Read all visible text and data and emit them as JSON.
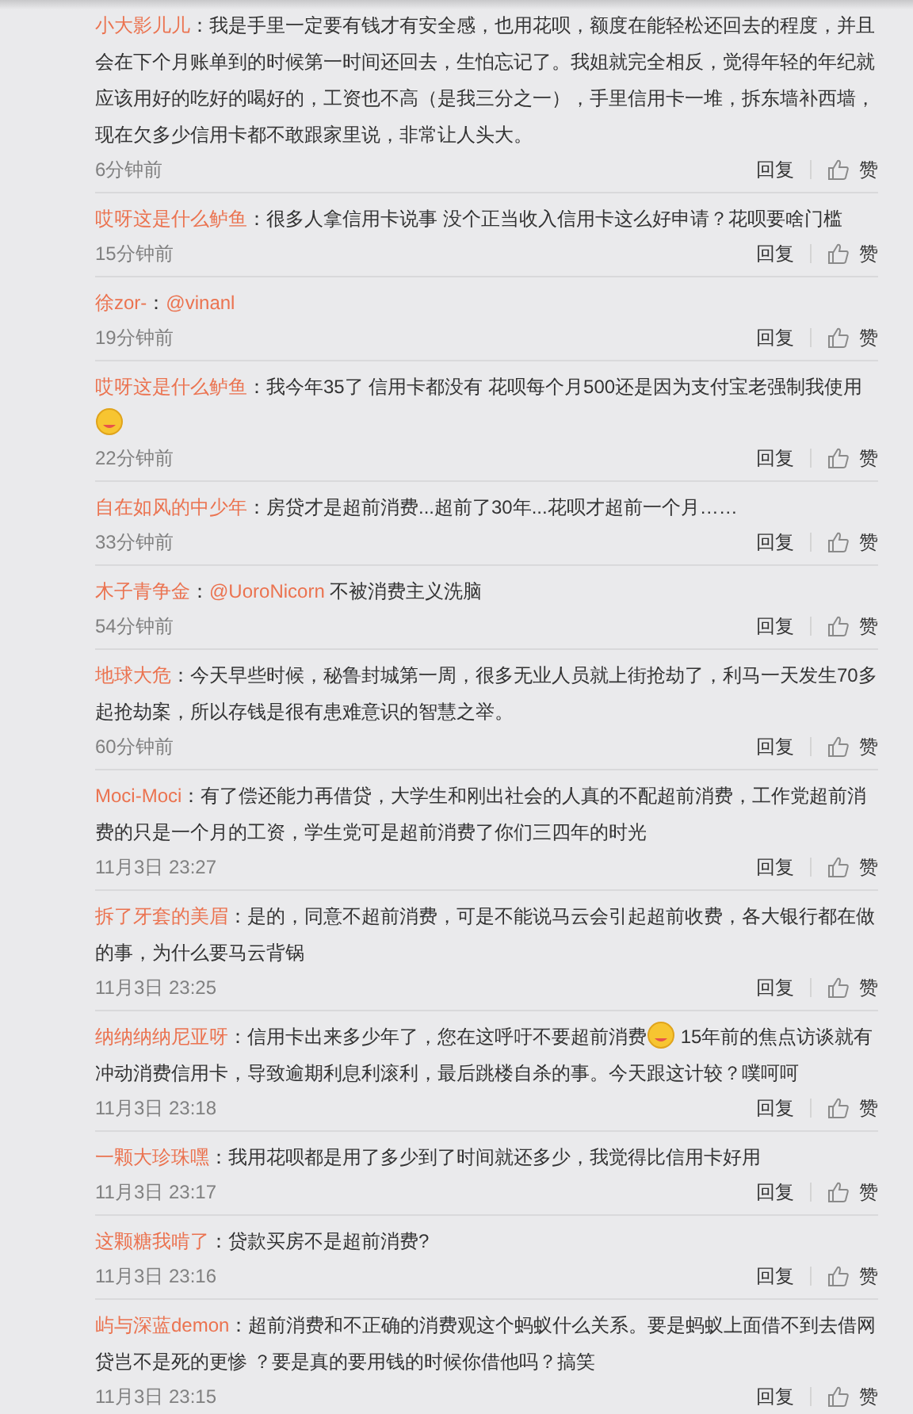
{
  "comments": [
    {
      "user": "小大影儿儿",
      "body": [
        {
          "kind": "text",
          "text": "：我是手里一定要有钱才有安全感，也用花呗，额度在能轻松还回去的程度，并且会在下个月账单到的时候第一时间还回去，生怕忘记了。我姐就完全相反，觉得年轻的年纪就应该用好的吃好的喝好的，工资也不高（是我三分之一），手里信用卡一堆，拆东墙补西墙，现在欠多少信用卡都不敢跟家里说，非常让人头大。"
        }
      ],
      "time": "6分钟前",
      "reply": "回复",
      "like": "赞"
    },
    {
      "user": "哎呀这是什么鲈鱼",
      "body": [
        {
          "kind": "text",
          "text": "：很多人拿信用卡说事 没个正当收入信用卡这么好申请？花呗要啥门槛"
        }
      ],
      "time": "15分钟前",
      "reply": "回复",
      "like": "赞"
    },
    {
      "user": "徐zor-",
      "body": [
        {
          "kind": "text",
          "text": "："
        },
        {
          "kind": "mention",
          "text": "@vinanl"
        }
      ],
      "time": "19分钟前",
      "reply": "回复",
      "like": "赞"
    },
    {
      "user": "哎呀这是什么鲈鱼",
      "body": [
        {
          "kind": "text",
          "text": "：我今年35了 信用卡都没有 花呗每个月500还是因为支付宝老强制我使用"
        },
        {
          "kind": "emoji"
        }
      ],
      "time": "22分钟前",
      "reply": "回复",
      "like": "赞"
    },
    {
      "user": "自在如风的中少年",
      "body": [
        {
          "kind": "text",
          "text": "：房贷才是超前消费...超前了30年...花呗才超前一个月……"
        }
      ],
      "time": "33分钟前",
      "reply": "回复",
      "like": "赞"
    },
    {
      "user": "木子青争金",
      "body": [
        {
          "kind": "text",
          "text": "："
        },
        {
          "kind": "mention",
          "text": "@UoroNicorn"
        },
        {
          "kind": "text",
          "text": " 不被消费主义洗脑"
        }
      ],
      "time": "54分钟前",
      "reply": "回复",
      "like": "赞"
    },
    {
      "user": "地球大危",
      "body": [
        {
          "kind": "text",
          "text": "：今天早些时候，秘鲁封城第一周，很多无业人员就上街抢劫了，利马一天发生70多起抢劫案，所以存钱是很有患难意识的智慧之举。"
        }
      ],
      "time": "60分钟前",
      "reply": "回复",
      "like": "赞"
    },
    {
      "user": "Moci-Moci",
      "body": [
        {
          "kind": "text",
          "text": "：有了偿还能力再借贷，大学生和刚出社会的人真的不配超前消费，工作党超前消费的只是一个月的工资，学生党可是超前消费了你们三四年的时光"
        }
      ],
      "time": "11月3日 23:27",
      "reply": "回复",
      "like": "赞"
    },
    {
      "user": "拆了牙套的美眉",
      "body": [
        {
          "kind": "text",
          "text": "：是的，同意不超前消费，可是不能说马云会引起超前收费，各大银行都在做的事，为什么要马云背锅"
        }
      ],
      "time": "11月3日 23:25",
      "reply": "回复",
      "like": "赞"
    },
    {
      "user": "纳纳纳纳尼亚呀",
      "body": [
        {
          "kind": "text",
          "text": "：信用卡出来多少年了，您在这呼吁不要超前消费"
        },
        {
          "kind": "emoji"
        },
        {
          "kind": "text",
          "text": " 15年前的焦点访谈就有冲动消费信用卡，导致逾期利息利滚利，最后跳楼自杀的事。今天跟这计较？噗呵呵"
        }
      ],
      "time": "11月3日 23:18",
      "reply": "回复",
      "like": "赞"
    },
    {
      "user": "一颗大珍珠嘿",
      "body": [
        {
          "kind": "text",
          "text": "：我用花呗都是用了多少到了时间就还多少，我觉得比信用卡好用"
        }
      ],
      "time": "11月3日 23:17",
      "reply": "回复",
      "like": "赞"
    },
    {
      "user": "这颗糖我啃了",
      "body": [
        {
          "kind": "text",
          "text": "：贷款买房不是超前消费?"
        }
      ],
      "time": "11月3日 23:16",
      "reply": "回复",
      "like": "赞"
    },
    {
      "user": "屿与深蓝demon",
      "body": [
        {
          "kind": "text",
          "text": "：超前消费和不正确的消费观这个蚂蚁什么关系。要是蚂蚁上面借不到去借网贷岂不是死的更惨 ？要是真的要用钱的时候你借他吗？搞笑"
        }
      ],
      "time": "11月3日 23:15",
      "reply": "回复",
      "like": "赞"
    }
  ]
}
